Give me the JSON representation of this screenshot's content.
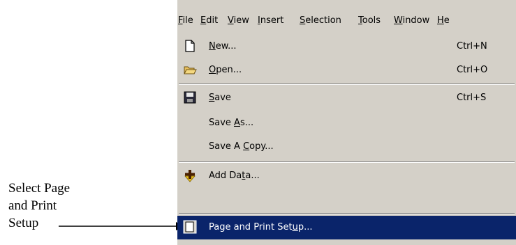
{
  "annotation": {
    "line1": "Select Page",
    "line2": "and Print",
    "line3": "Setup"
  },
  "menubar": {
    "items": [
      {
        "pre": "",
        "key": "F",
        "post": "ile"
      },
      {
        "pre": "",
        "key": "E",
        "post": "dit"
      },
      {
        "pre": "",
        "key": "V",
        "post": "iew"
      },
      {
        "pre": "",
        "key": "I",
        "post": "nsert"
      },
      {
        "pre": "",
        "key": "S",
        "post": "election"
      },
      {
        "pre": "",
        "key": "T",
        "post": "ools"
      },
      {
        "pre": "",
        "key": "W",
        "post": "indow"
      },
      {
        "pre": "",
        "key": "H",
        "post": "e"
      }
    ]
  },
  "file_menu": {
    "items": [
      {
        "pre": "",
        "key": "N",
        "post": "ew...",
        "shortcut": "Ctrl+N",
        "icon": "new-document-icon"
      },
      {
        "pre": "",
        "key": "O",
        "post": "pen...",
        "shortcut": "Ctrl+O",
        "icon": "open-folder-icon"
      },
      {
        "pre": "",
        "key": "S",
        "post": "ave",
        "shortcut": "Ctrl+S",
        "icon": "save-disk-icon"
      },
      {
        "pre": "Save ",
        "key": "A",
        "post": "s...",
        "shortcut": ""
      },
      {
        "pre": "Save A ",
        "key": "C",
        "post": "opy...",
        "shortcut": ""
      },
      {
        "pre": "Add Da",
        "key": "t",
        "post": "a...",
        "shortcut": "",
        "icon": "add-data-icon"
      },
      {
        "pre": "Page and Print Set",
        "key": "u",
        "post": "p...",
        "shortcut": "",
        "icon": "page-setup-icon"
      }
    ]
  },
  "colors": {
    "menu_bg": "#d4d0c8",
    "highlight_bg": "#0a246a",
    "highlight_text": "#ffffff"
  }
}
